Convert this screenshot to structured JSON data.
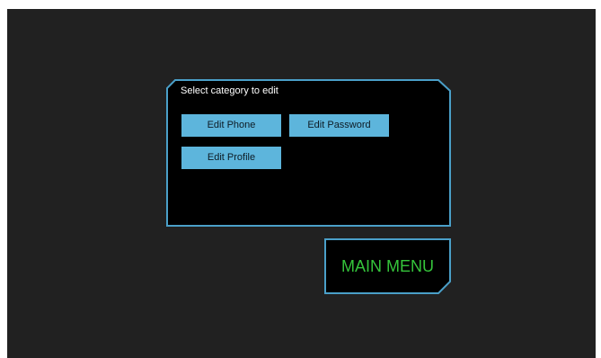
{
  "dialog": {
    "title": "Select category to edit",
    "buttons": {
      "edit_phone": "Edit Phone",
      "edit_password": "Edit Password",
      "edit_profile": "Edit Profile"
    }
  },
  "main_menu": {
    "label": "MAIN MENU"
  },
  "colors": {
    "background": "#212121",
    "panel": "#000000",
    "border": "#4a9fc8",
    "button": "#5db5dc",
    "menu_text": "#35c43b"
  }
}
